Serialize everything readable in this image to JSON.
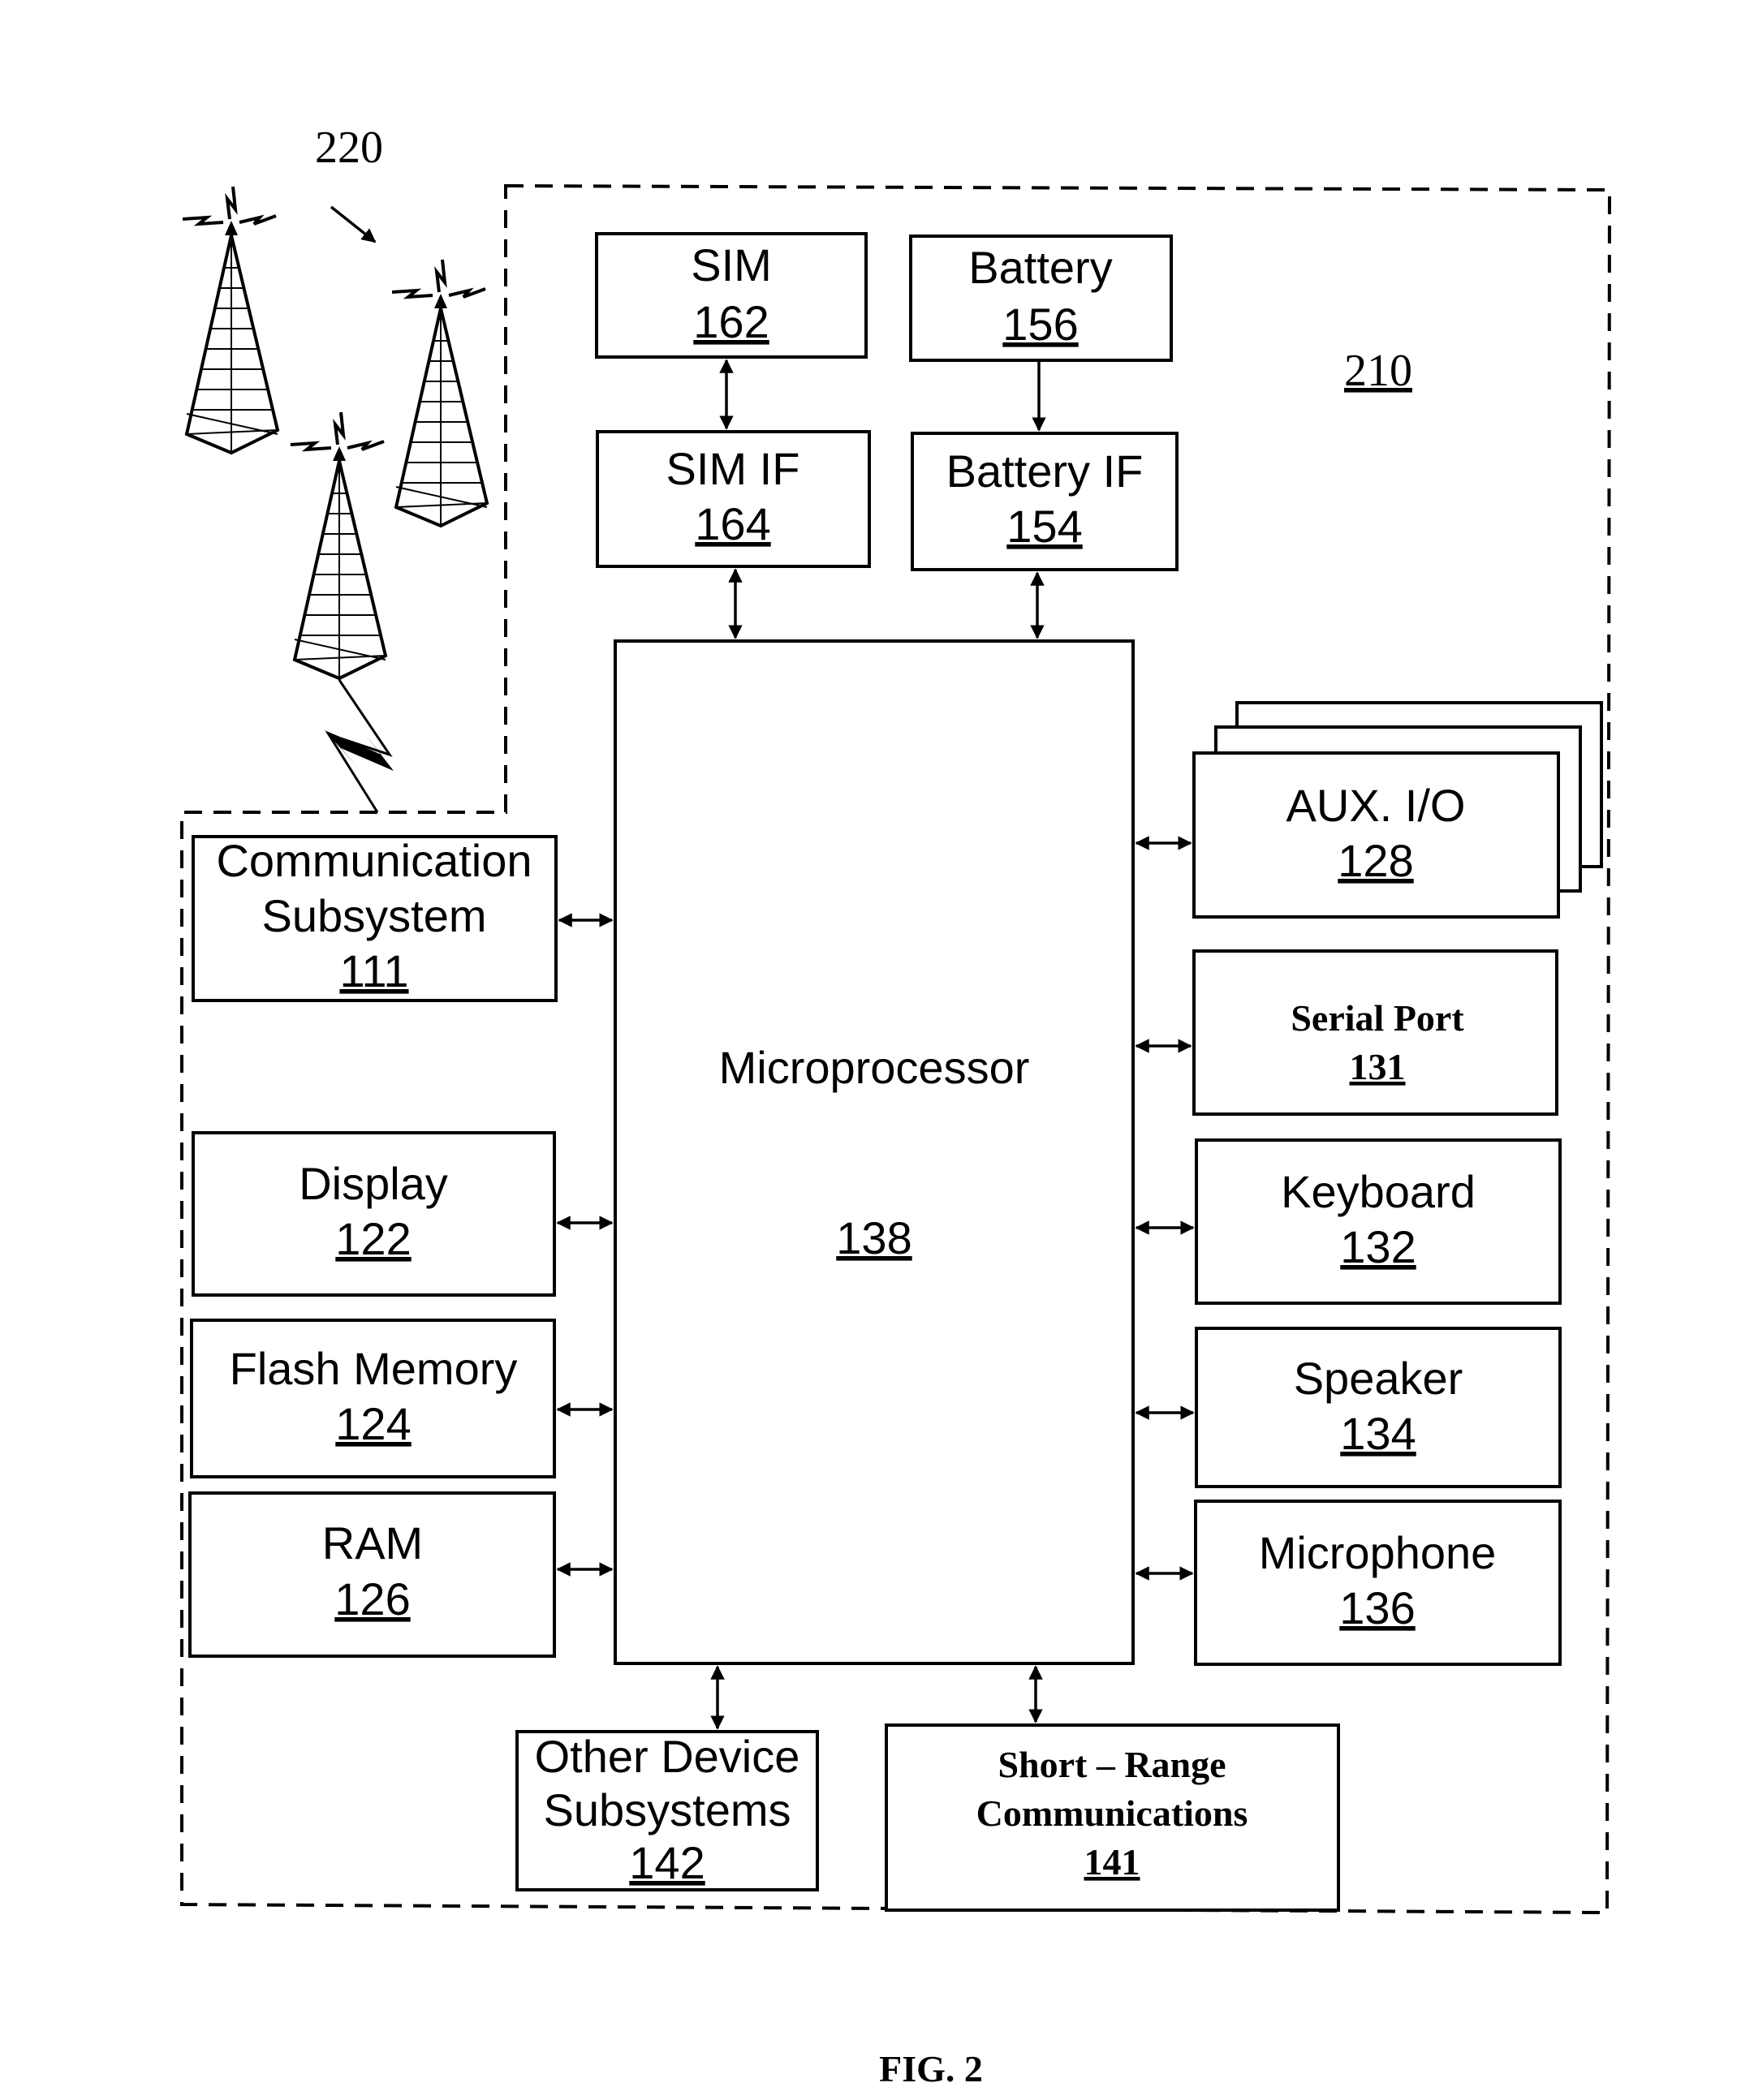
{
  "figure_label": "FIG. 2",
  "refs": {
    "network": "220",
    "device": "210"
  },
  "blocks": {
    "sim": {
      "title": "SIM",
      "ref": "162"
    },
    "battery": {
      "title": "Battery",
      "ref": "156"
    },
    "sim_if": {
      "title": "SIM IF",
      "ref": "164"
    },
    "battery_if": {
      "title": "Battery IF",
      "ref": "154"
    },
    "microprocessor": {
      "title": "Microprocessor",
      "ref": "138"
    },
    "comm": {
      "line1": "Communication",
      "line2": "Subsystem",
      "ref": "111"
    },
    "display": {
      "title": "Display",
      "ref": "122"
    },
    "flash": {
      "title": "Flash Memory",
      "ref": "124"
    },
    "ram": {
      "title": "RAM",
      "ref": "126"
    },
    "aux": {
      "title": "AUX. I/O",
      "ref": "128"
    },
    "serial": {
      "title": "Serial Port",
      "ref": "131"
    },
    "keyboard": {
      "title": "Keyboard",
      "ref": "132"
    },
    "speaker": {
      "title": "Speaker",
      "ref": "134"
    },
    "microphone": {
      "title": "Microphone",
      "ref": "136"
    },
    "other": {
      "line1": "Other Device",
      "line2": "Subsystems",
      "ref": "142"
    },
    "short_range": {
      "line1": "Short – Range",
      "line2": "Communications",
      "ref": "141"
    }
  }
}
